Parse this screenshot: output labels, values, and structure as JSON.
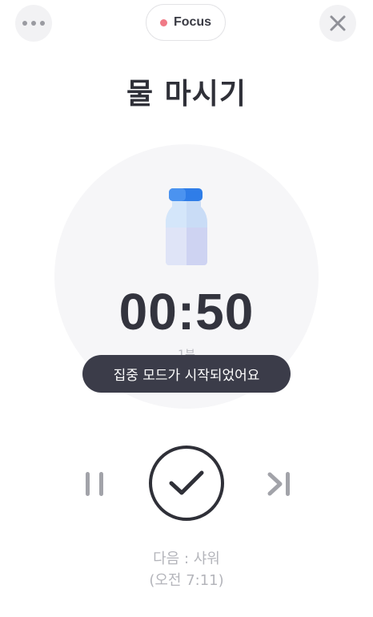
{
  "header": {
    "more_icon": "more-horizontal-icon",
    "focus_label": "Focus",
    "focus_dot_color": "#f07a86",
    "close_icon": "close-icon"
  },
  "task": {
    "title": "물 마시기",
    "icon": "water-bottle-icon",
    "timer": "00:50",
    "duration": "1분"
  },
  "toast": {
    "message": "집중 모드가 시작되었어요"
  },
  "controls": {
    "pause_icon": "pause-icon",
    "complete_icon": "check-icon",
    "skip_icon": "skip-next-icon"
  },
  "next": {
    "label": "다음 : 샤워",
    "time": "(오전 7:11)"
  },
  "colors": {
    "text_dark": "#2f3038",
    "toast_bg": "#3b3c49",
    "circle_bg": "#f6f6f8",
    "bottle_cap": "#2f7de8",
    "muted": "#b4b5bb"
  }
}
